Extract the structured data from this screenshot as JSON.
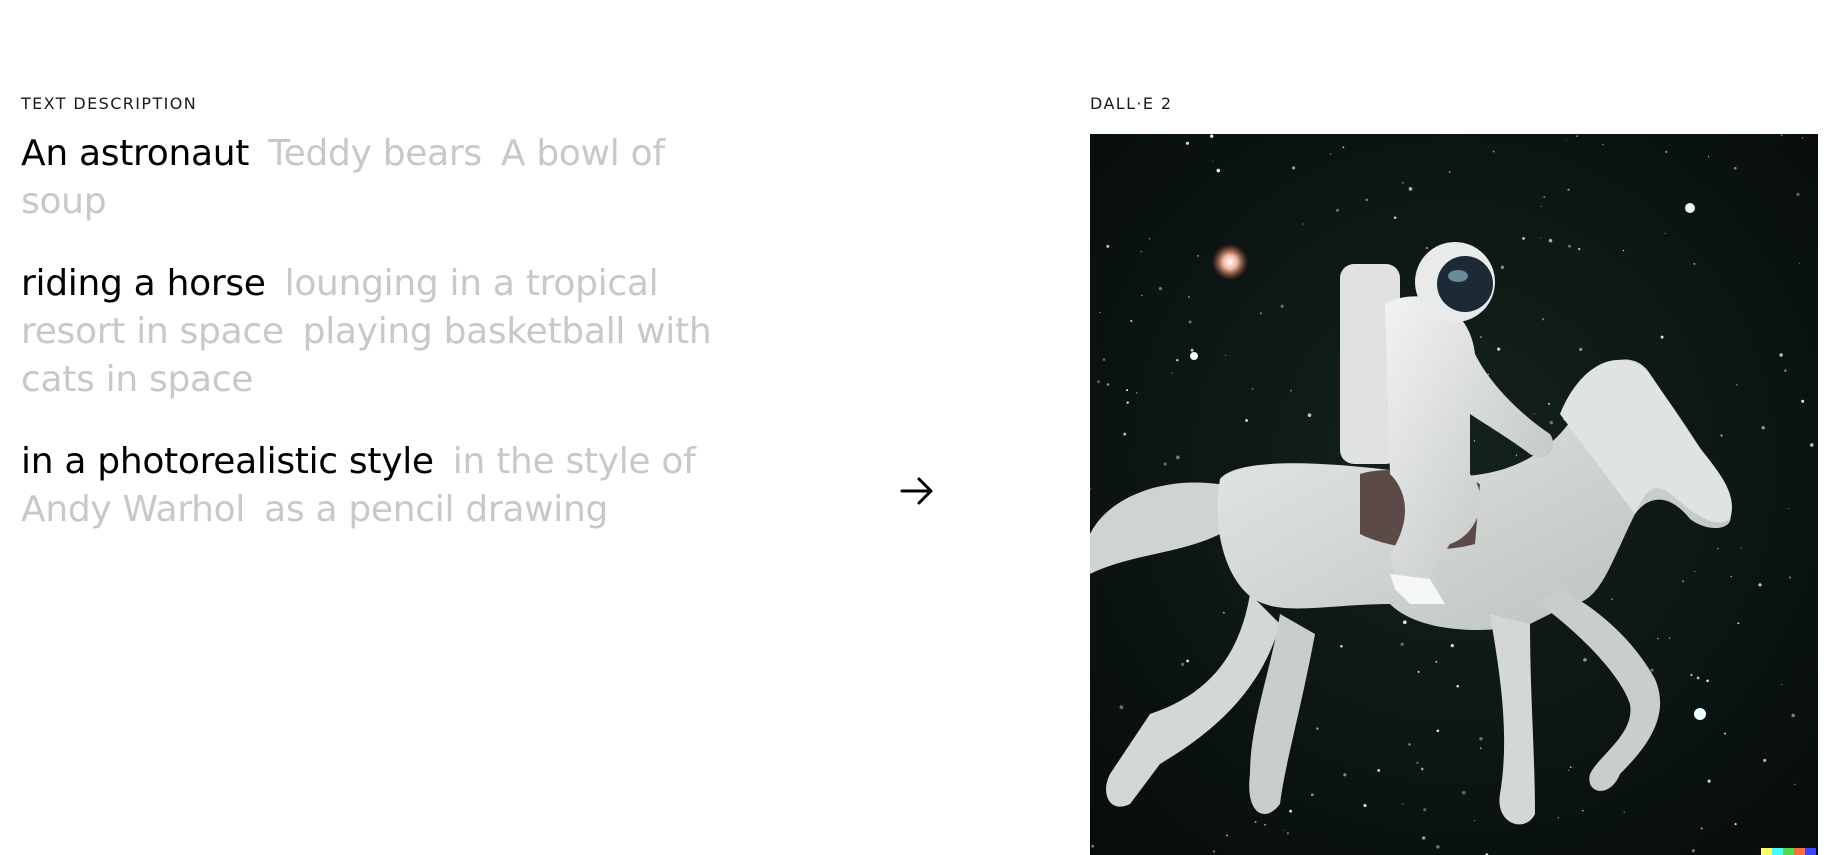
{
  "left_label": "TEXT DESCRIPTION",
  "right_label": "DALL·E 2",
  "rows": [
    {
      "options": [
        "An astronaut",
        "Teddy bears",
        "A bowl of soup"
      ],
      "selected": 0
    },
    {
      "options": [
        "riding a horse",
        "lounging in a tropical resort in space",
        "playing basketball with cats in space"
      ],
      "selected": 0
    },
    {
      "options": [
        "in a photorealistic style",
        "in the style of Andy Warhol",
        "as a pencil drawing"
      ],
      "selected": 0
    }
  ],
  "arrow_icon": "arrow-right-icon",
  "image": {
    "subject": "astronaut-riding-horse",
    "background_color": "#0c1512",
    "signature_colors": [
      "#ffff66",
      "#42ffff",
      "#51da4c",
      "#ff6e3c",
      "#3c46ff"
    ]
  }
}
